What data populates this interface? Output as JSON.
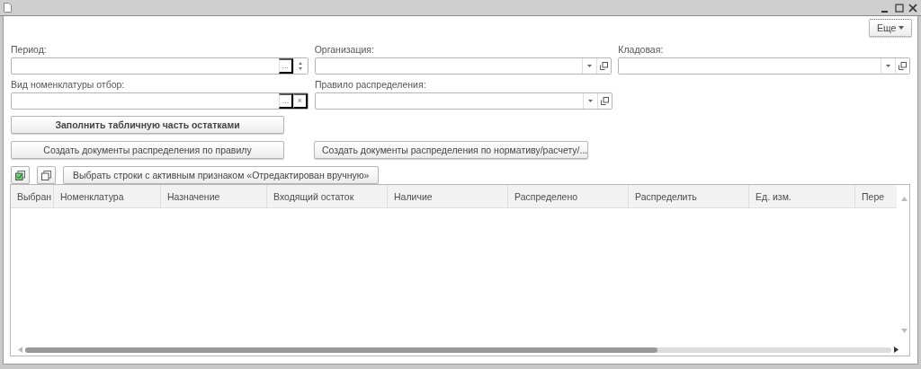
{
  "toolbar": {
    "more_button": "Еще"
  },
  "fields": [
    {
      "label": "Период:",
      "kind": "period",
      "buttons": [
        "..."
      ]
    },
    {
      "label": "Организация:",
      "kind": "choice"
    },
    {
      "label": "Кладовая:",
      "kind": "choice"
    },
    {
      "label": "Вид номенклатуры отбор:",
      "kind": "select",
      "buttons": [
        "...",
        "×"
      ]
    },
    {
      "label": "Правило распределения:",
      "kind": "choice"
    }
  ],
  "buttons": [
    {
      "label": "Заполнить табличную часть остатками",
      "bold": true
    },
    {
      "label": "Создать документы распределения по правилу",
      "bold": false
    },
    {
      "label": "Создать документы распределения по нормативу/расчету/...",
      "bold": false
    }
  ],
  "table_toolbar": {
    "button": "Выбрать строки с активным признаком «Отредактирован вручную»"
  },
  "table": {
    "columns": [
      "Выбран",
      "Номенклатура",
      "Назначение",
      "Входящий остаток",
      "Наличие",
      "Распределено",
      "Распределить",
      "Ед. изм.",
      "Пере"
    ]
  }
}
